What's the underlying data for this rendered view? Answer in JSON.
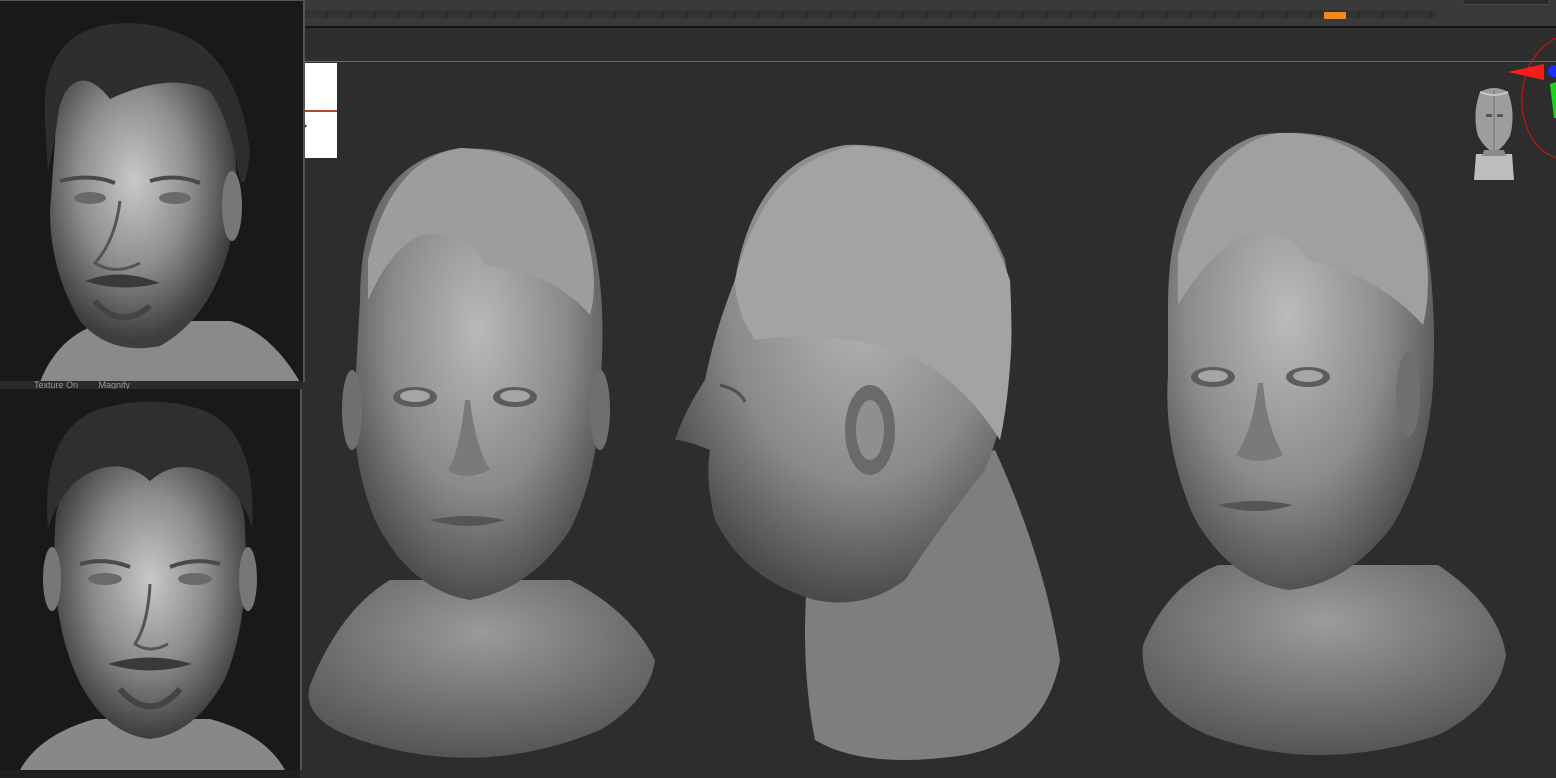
{
  "reference_panel": {
    "caption_items": [
      "Texture On",
      "Magnify"
    ],
    "top_view": "face-three-quarter",
    "bottom_view": "face-front"
  },
  "viewport": {
    "models": [
      "head-front",
      "head-side",
      "head-three-quarter"
    ],
    "colors": {
      "canvas": "#2d2d2d",
      "timeline_marker": "#f08a1e",
      "gizmo_x": "#ff1a1a",
      "gizmo_y": "#1ad41a",
      "gizmo_z": "#1a2cff"
    }
  },
  "icons": [
    "navigation-cube-icon",
    "transpose-gizmo-icon"
  ]
}
